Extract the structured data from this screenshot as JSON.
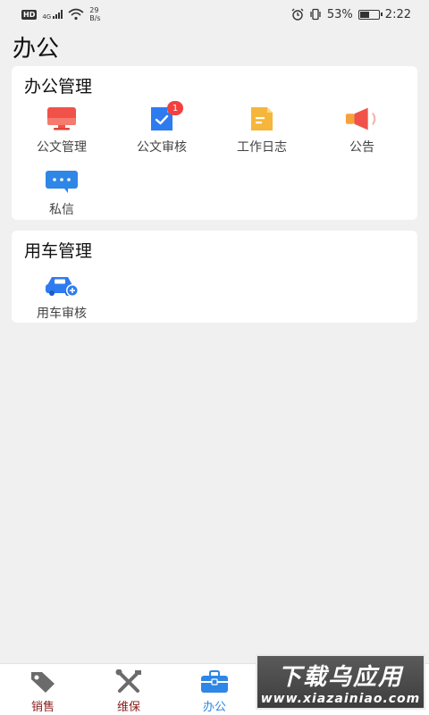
{
  "status_bar": {
    "hd": "HD",
    "network": "4G",
    "speed_value": "29",
    "speed_unit": "B/s",
    "battery_percent": "53%",
    "battery_level": 0.53,
    "time": "2:22"
  },
  "page": {
    "title": "办公"
  },
  "office_section": {
    "title": "办公管理",
    "items": [
      {
        "label": "公文管理",
        "icon": "monitor-icon",
        "color": "#f0524a"
      },
      {
        "label": "公文审核",
        "icon": "document-check-icon",
        "color": "#2e7bf0",
        "badge": "1"
      },
      {
        "label": "工作日志",
        "icon": "notepad-icon",
        "color": "#f5b63b"
      },
      {
        "label": "公告",
        "icon": "megaphone-icon",
        "color": "#f0524a"
      },
      {
        "label": "私信",
        "icon": "chat-bubble-icon",
        "color": "#2e86e6"
      }
    ]
  },
  "car_section": {
    "title": "用车管理",
    "items": [
      {
        "label": "用车审核",
        "icon": "car-icon",
        "color": "#2e7bf0"
      }
    ]
  },
  "bottom_nav": {
    "items": [
      {
        "label": "销售",
        "icon": "price-tag-icon",
        "active": false
      },
      {
        "label": "维保",
        "icon": "tools-icon",
        "active": false
      },
      {
        "label": "办公",
        "icon": "briefcase-icon",
        "active": true
      }
    ],
    "active_color": "#2e86e6",
    "inactive_color": "#8a1d1d"
  },
  "watermark": {
    "main": "下载乌应用",
    "url": "www.xiazainiao.com"
  }
}
